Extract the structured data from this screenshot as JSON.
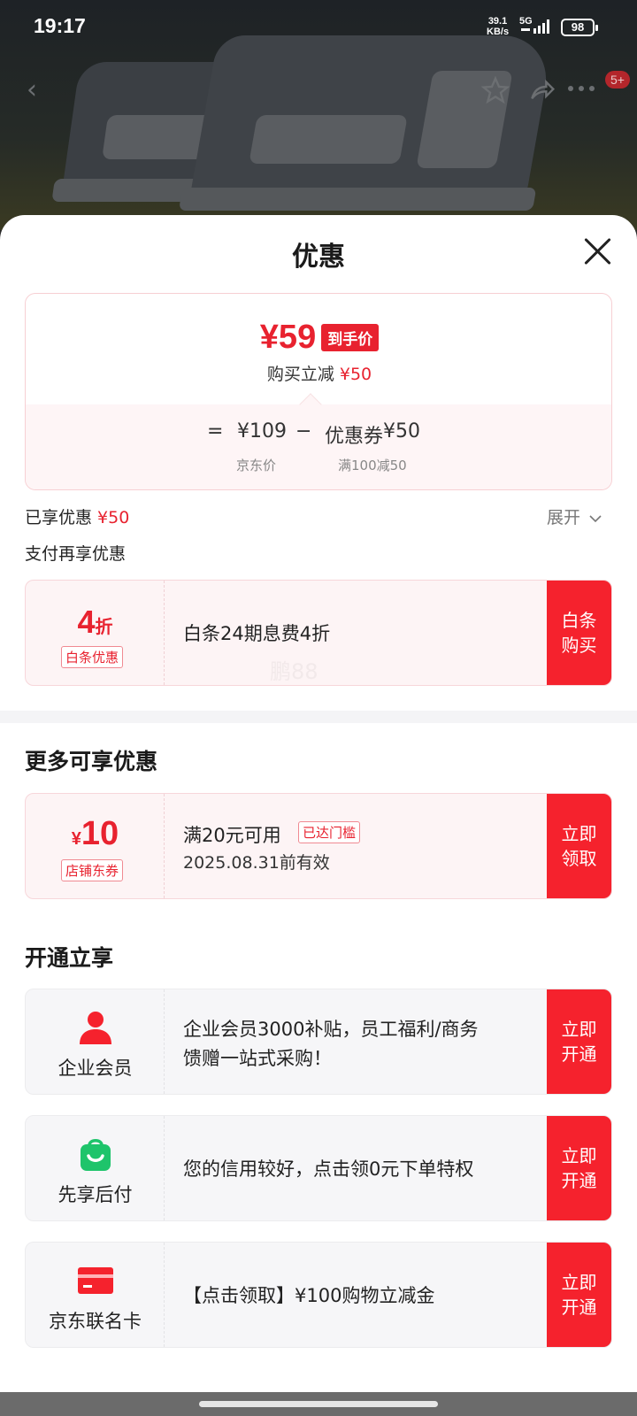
{
  "status_bar": {
    "time": "19:17",
    "network_speed": "39.1",
    "network_unit": "KB/s",
    "network_type": "5G",
    "battery": "98"
  },
  "nav": {
    "back_icon": "chevron-left-icon",
    "favorite_icon": "star-icon",
    "share_icon": "share-icon",
    "more_icon": "more-icon",
    "badge": "5+"
  },
  "sheet": {
    "title": "优惠"
  },
  "price": {
    "final": "¥59",
    "final_tag": "到手价",
    "reduce_label": "购买立减",
    "reduce_value": "¥50",
    "equals": "=",
    "jd_price": "¥109",
    "minus": "−",
    "coupon_label": "优惠券",
    "coupon_value": "¥50",
    "jd_price_label": "京东价",
    "coupon_rule": "满100减50"
  },
  "enjoyed": {
    "label": "已享优惠",
    "value": "¥50",
    "expand": "展开"
  },
  "pay_more": "支付再享优惠",
  "baitiao": {
    "discount": "4",
    "discount_unit": "折",
    "tag": "白条优惠",
    "desc": "白条24期息费4折",
    "action": "白条购买",
    "watermark": "鹏88"
  },
  "more_section": {
    "title": "更多可享优惠"
  },
  "shop_coupon": {
    "currency": "¥",
    "amount": "10",
    "tag": "店铺东券",
    "desc": "满20元可用",
    "status": "已达门槛",
    "validity": "2025.08.31前有效",
    "action": "立即领取"
  },
  "open_section": {
    "title": "开通立享"
  },
  "services": [
    {
      "name": "企业会员",
      "icon": "person-icon",
      "desc_line1": " 企业会员3000补贴，员工福利/商务",
      "desc_line2": "馈赠一站式采购！",
      "action": "立即开通"
    },
    {
      "name": "先享后付",
      "icon": "shopping-bag-icon",
      "desc_line1": "您的信用较好，点击领0元下单特权",
      "desc_line2": "",
      "action": "立即开通"
    },
    {
      "name": "京东联名卡",
      "icon": "credit-card-icon",
      "desc_line1": "【点击领取】¥100购物立减金",
      "desc_line2": "",
      "action": "立即开通"
    }
  ],
  "colors": {
    "accent": "#f5222d",
    "price_red": "#e8222f",
    "coupon_bg": "#fdf4f5"
  }
}
